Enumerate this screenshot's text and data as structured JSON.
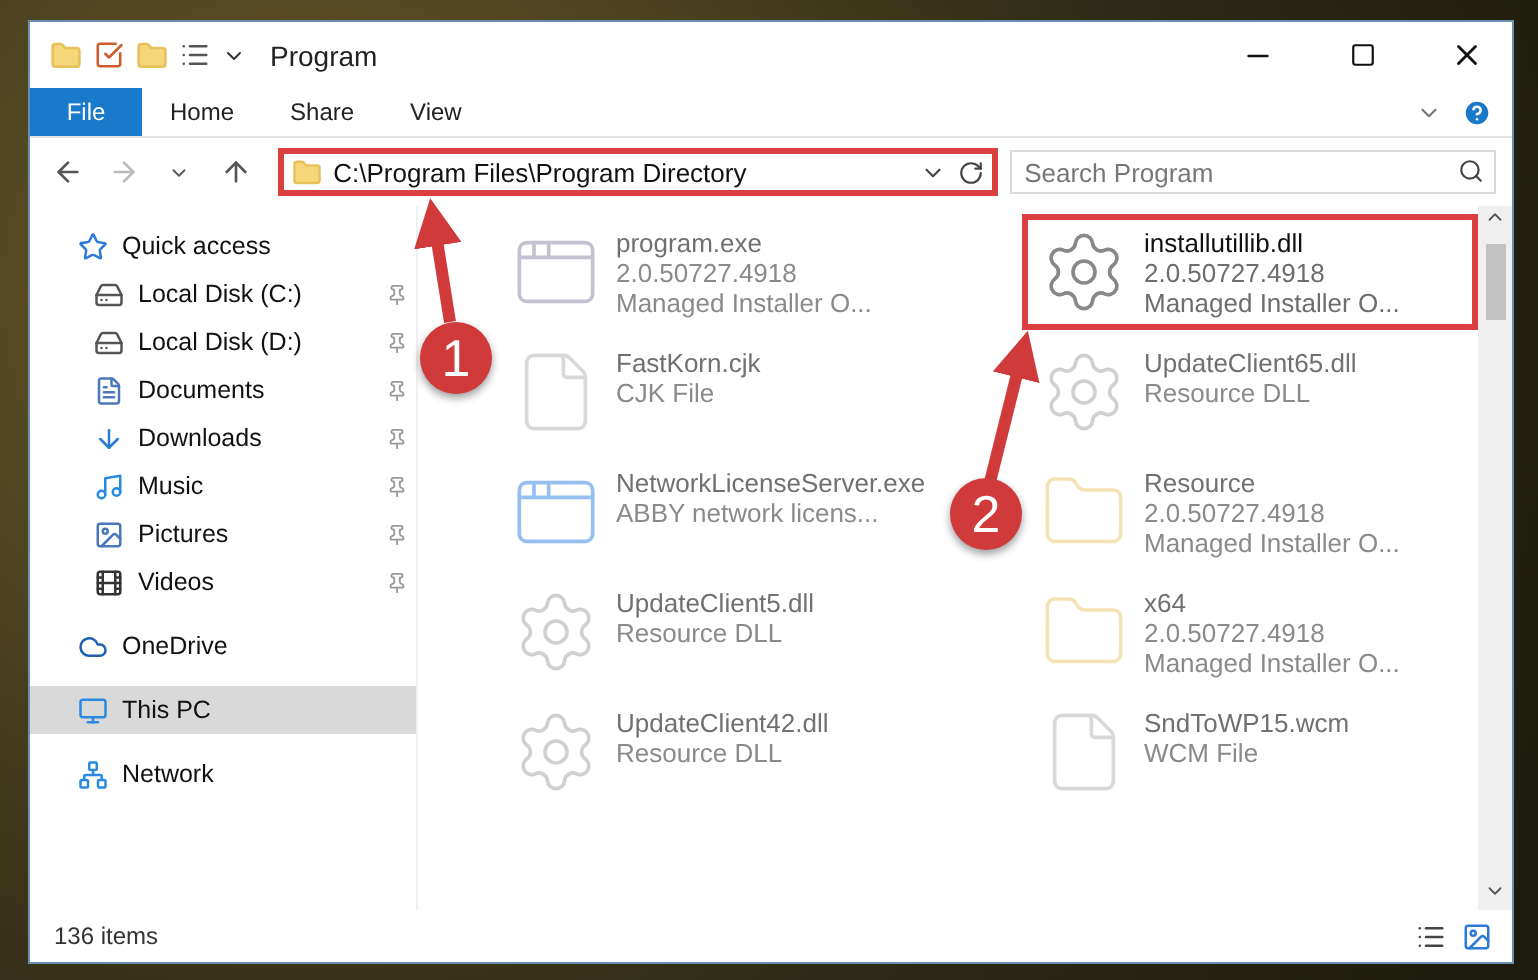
{
  "window": {
    "title": "Program"
  },
  "ribbon": {
    "tabs": [
      {
        "label": "File",
        "kind": "file"
      },
      {
        "label": "Home",
        "kind": "tab"
      },
      {
        "label": "Share",
        "kind": "tab"
      },
      {
        "label": "View",
        "kind": "tab"
      }
    ]
  },
  "address_bar": {
    "path": "C:\\Program Files\\Program Directory",
    "highlighted": true
  },
  "search": {
    "placeholder": "Search Program"
  },
  "sidebar": {
    "items": [
      {
        "label": "Quick access",
        "selected": false,
        "children": [
          {
            "label": "Local Disk (C:)",
            "selected": false,
            "pinned": true
          },
          {
            "label": "Local Disk (D:)",
            "selected": false,
            "pinned": true
          },
          {
            "label": "Documents",
            "selected": false,
            "pinned": true
          },
          {
            "label": "Downloads",
            "selected": false,
            "pinned": true
          },
          {
            "label": "Music",
            "selected": false,
            "pinned": true
          },
          {
            "label": "Pictures",
            "selected": false,
            "pinned": true
          },
          {
            "label": "Videos",
            "selected": false,
            "pinned": true
          }
        ]
      },
      {
        "label": "OneDrive",
        "selected": false
      },
      {
        "label": "This PC",
        "selected": true
      },
      {
        "label": "Network",
        "selected": false
      }
    ]
  },
  "files": [
    {
      "name": "program.exe",
      "lines": [
        "2.0.50727.4918",
        "Managed Installer O..."
      ],
      "dimmed": true,
      "highlighted": false
    },
    {
      "name": "installutillib.dll",
      "lines": [
        "2.0.50727.4918",
        "Managed Installer O..."
      ],
      "dimmed": false,
      "highlighted": true
    },
    {
      "name": "FastKorn.cjk",
      "lines": [
        "CJK File"
      ],
      "dimmed": true,
      "highlighted": false
    },
    {
      "name": "UpdateClient65.dll",
      "lines": [
        "Resource DLL"
      ],
      "dimmed": true,
      "highlighted": false
    },
    {
      "name": "NetworkLicenseServer.exe",
      "lines": [
        "ABBY network licens..."
      ],
      "dimmed": true,
      "highlighted": false
    },
    {
      "name": "Resource",
      "lines": [
        "2.0.50727.4918",
        "Managed Installer O..."
      ],
      "dimmed": true,
      "highlighted": false
    },
    {
      "name": "UpdateClient5.dll",
      "lines": [
        "Resource DLL"
      ],
      "dimmed": true,
      "highlighted": false
    },
    {
      "name": "x64",
      "lines": [
        "2.0.50727.4918",
        "Managed Installer O..."
      ],
      "dimmed": true,
      "highlighted": false
    },
    {
      "name": "UpdateClient42.dll",
      "lines": [
        "Resource DLL"
      ],
      "dimmed": true,
      "highlighted": false
    },
    {
      "name": "SndToWP15.wcm",
      "lines": [
        "WCM File"
      ],
      "dimmed": true,
      "highlighted": false
    }
  ],
  "status_bar": {
    "count": "136 items"
  },
  "callouts": [
    {
      "label": "1"
    },
    {
      "label": "2"
    }
  ]
}
